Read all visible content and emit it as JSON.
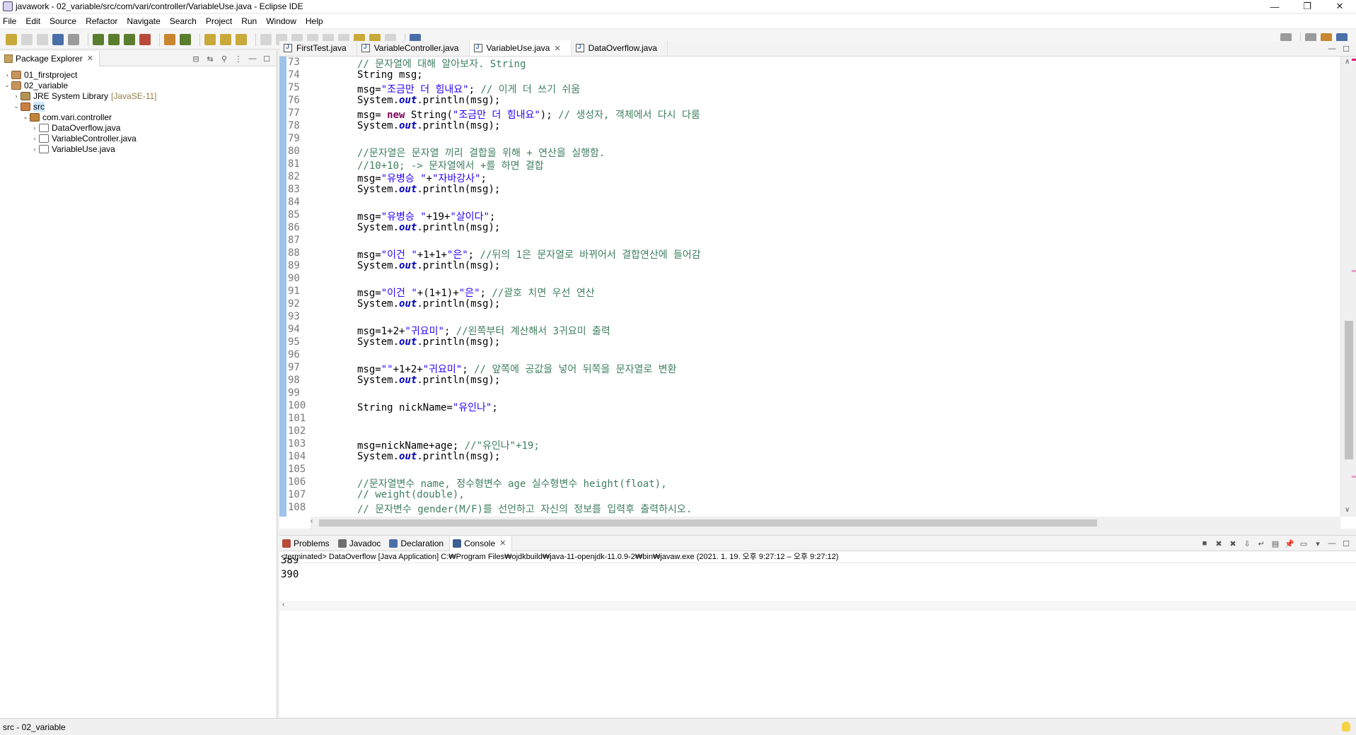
{
  "window": {
    "title": "javawork - 02_variable/src/com/vari/controller/VariableUse.java - Eclipse IDE",
    "controls": [
      "—",
      "❐",
      "✕"
    ]
  },
  "menu": [
    "File",
    "Edit",
    "Source",
    "Refactor",
    "Navigate",
    "Search",
    "Project",
    "Run",
    "Window",
    "Help"
  ],
  "explorer": {
    "tab_label": "Package Explorer",
    "close": "✕",
    "tree": [
      {
        "label": "01_firstproject",
        "icon": "project-icon",
        "depth": 0,
        "arrow": "›"
      },
      {
        "label": "02_variable",
        "icon": "project-icon",
        "depth": 0,
        "arrow": "⌄"
      },
      {
        "label": "JRE System Library",
        "suffix": "[JavaSE-11]",
        "icon": "library-icon",
        "depth": 1,
        "arrow": "›"
      },
      {
        "label": "src",
        "icon": "source-folder-icon",
        "depth": 1,
        "arrow": "⌄",
        "selected": true
      },
      {
        "label": "com.vari.controller",
        "icon": "package-icon",
        "depth": 2,
        "arrow": "⌄"
      },
      {
        "label": "DataOverflow.java",
        "icon": "java-file-icon",
        "depth": 3,
        "arrow": "›"
      },
      {
        "label": "VariableController.java",
        "icon": "java-file-icon",
        "depth": 3,
        "arrow": "›"
      },
      {
        "label": "VariableUse.java",
        "icon": "java-file-icon",
        "depth": 3,
        "arrow": "›"
      }
    ]
  },
  "editor": {
    "tabs": [
      {
        "label": "FirstTest.java",
        "active": false
      },
      {
        "label": "VariableController.java",
        "active": false
      },
      {
        "label": "VariableUse.java",
        "active": true,
        "close": "✕"
      },
      {
        "label": "DataOverflow.java",
        "active": false
      }
    ],
    "lines": [
      {
        "n": "73",
        "seg": [
          [
            "cm",
            "// 문자열에 대해 알아보자. String"
          ]
        ]
      },
      {
        "n": "74",
        "seg": [
          [
            "",
            "String msg;"
          ]
        ]
      },
      {
        "n": "75",
        "seg": [
          [
            "",
            "msg="
          ],
          [
            "st",
            "\"조금만 더 힘내요\""
          ],
          [
            "",
            "; "
          ],
          [
            "cm",
            "// 이게 더 쓰기 쉬움"
          ]
        ]
      },
      {
        "n": "76",
        "seg": [
          [
            "",
            "System."
          ],
          [
            "fld",
            "out"
          ],
          [
            "",
            ".println(msg);"
          ]
        ]
      },
      {
        "n": "77",
        "seg": [
          [
            "",
            "msg= "
          ],
          [
            "kw",
            "new"
          ],
          [
            "",
            " String("
          ],
          [
            "st",
            "\"조금만 더 힘내요\""
          ],
          [
            "",
            "); "
          ],
          [
            "cm",
            "// 생성자, 객체에서 다시 다룸"
          ]
        ]
      },
      {
        "n": "78",
        "seg": [
          [
            "",
            "System."
          ],
          [
            "fld",
            "out"
          ],
          [
            "",
            ".println(msg);"
          ]
        ]
      },
      {
        "n": "79",
        "seg": []
      },
      {
        "n": "80",
        "seg": [
          [
            "cm",
            "//문자열은 문자열 끼리 결합을 위해 + 연산을 실행함."
          ]
        ]
      },
      {
        "n": "81",
        "seg": [
          [
            "cm",
            "//10+10; -> 문자열에서 +를 하면 결합"
          ]
        ]
      },
      {
        "n": "82",
        "seg": [
          [
            "",
            "msg="
          ],
          [
            "st",
            "\"유병승 \""
          ],
          [
            "",
            "+"
          ],
          [
            "st",
            "\"자바강사\""
          ],
          [
            "",
            ";"
          ]
        ]
      },
      {
        "n": "83",
        "seg": [
          [
            "",
            "System."
          ],
          [
            "fld",
            "out"
          ],
          [
            "",
            ".println(msg);"
          ]
        ]
      },
      {
        "n": "84",
        "seg": []
      },
      {
        "n": "85",
        "seg": [
          [
            "",
            "msg="
          ],
          [
            "st",
            "\"유병승 \""
          ],
          [
            "",
            "+19+"
          ],
          [
            "st",
            "\"살이다\""
          ],
          [
            "",
            ";"
          ]
        ]
      },
      {
        "n": "86",
        "seg": [
          [
            "",
            "System."
          ],
          [
            "fld",
            "out"
          ],
          [
            "",
            ".println(msg);"
          ]
        ]
      },
      {
        "n": "87",
        "seg": []
      },
      {
        "n": "88",
        "seg": [
          [
            "",
            "msg="
          ],
          [
            "st",
            "\"이건 \""
          ],
          [
            "",
            "+1+1+"
          ],
          [
            "st",
            "\"은\""
          ],
          [
            "",
            "; "
          ],
          [
            "cm",
            "//뒤의 1은 문자열로 바뀌어서 결합연산에 들어감"
          ]
        ]
      },
      {
        "n": "89",
        "seg": [
          [
            "",
            "System."
          ],
          [
            "fld",
            "out"
          ],
          [
            "",
            ".println(msg);"
          ]
        ]
      },
      {
        "n": "90",
        "seg": []
      },
      {
        "n": "91",
        "seg": [
          [
            "",
            "msg="
          ],
          [
            "st",
            "\"이건 \""
          ],
          [
            "",
            "+(1+1)+"
          ],
          [
            "st",
            "\"은\""
          ],
          [
            "",
            "; "
          ],
          [
            "cm",
            "//괄호 치면 우선 연산"
          ]
        ]
      },
      {
        "n": "92",
        "seg": [
          [
            "",
            "System."
          ],
          [
            "fld",
            "out"
          ],
          [
            "",
            ".println(msg);"
          ]
        ]
      },
      {
        "n": "93",
        "seg": []
      },
      {
        "n": "94",
        "seg": [
          [
            "",
            "msg=1+2+"
          ],
          [
            "st",
            "\"귀요미\""
          ],
          [
            "",
            "; "
          ],
          [
            "cm",
            "//왼쪽부터 계산해서 3귀요미 출력"
          ]
        ]
      },
      {
        "n": "95",
        "seg": [
          [
            "",
            "System."
          ],
          [
            "fld",
            "out"
          ],
          [
            "",
            ".println(msg);"
          ]
        ]
      },
      {
        "n": "96",
        "seg": []
      },
      {
        "n": "97",
        "seg": [
          [
            "",
            "msg="
          ],
          [
            "st",
            "\"\""
          ],
          [
            "",
            "+1+2+"
          ],
          [
            "st",
            "\"귀요미\""
          ],
          [
            "",
            "; "
          ],
          [
            "cm",
            "// 앞쪽에 공값을 넣어 뒤쪽을 문자열로 변환"
          ]
        ]
      },
      {
        "n": "98",
        "seg": [
          [
            "",
            "System."
          ],
          [
            "fld",
            "out"
          ],
          [
            "",
            ".println(msg);"
          ]
        ]
      },
      {
        "n": "99",
        "seg": []
      },
      {
        "n": "100",
        "seg": [
          [
            "",
            "String nickName="
          ],
          [
            "st",
            "\"유인나\""
          ],
          [
            "",
            ";"
          ]
        ]
      },
      {
        "n": "101",
        "seg": []
      },
      {
        "n": "102",
        "seg": []
      },
      {
        "n": "103",
        "seg": [
          [
            "",
            "msg=nickName+age; "
          ],
          [
            "cm",
            "//\"유인나\"+19;"
          ]
        ]
      },
      {
        "n": "104",
        "seg": [
          [
            "",
            "System."
          ],
          [
            "fld",
            "out"
          ],
          [
            "",
            ".println(msg);"
          ]
        ]
      },
      {
        "n": "105",
        "seg": []
      },
      {
        "n": "106",
        "seg": [
          [
            "cm",
            "//문자열변수 name, 정수형변수 age 실수형변수 height(float),"
          ]
        ]
      },
      {
        "n": "107",
        "seg": [
          [
            "cm",
            "// weight(double),"
          ]
        ]
      },
      {
        "n": "108",
        "seg": [
          [
            "cm",
            "// 문자변수 gender(M/F)를 선언하고 자신의 정보를 입력후 출력하시오."
          ]
        ]
      }
    ]
  },
  "console_panel": {
    "tabs": [
      {
        "label": "Problems",
        "icon": "problems-icon"
      },
      {
        "label": "Javadoc",
        "icon": "javadoc-icon"
      },
      {
        "label": "Declaration",
        "icon": "declaration-icon"
      },
      {
        "label": "Console",
        "icon": "console-icon",
        "active": true,
        "close": "✕"
      }
    ],
    "status": "<terminated> DataOverflow [Java Application] C:₩Program Files₩ojdkbuild₩java-11-openjdk-11.0.9-2₩bin₩javaw.exe  (2021. 1. 19. 오후 9:27:12 – 오후 9:27:12)",
    "prev_output": "389",
    "output": "390"
  },
  "statusbar": {
    "text": "src - 02_variable"
  },
  "colors": {
    "comment": "#3f7f5f",
    "string": "#2a00ff",
    "keyword": "#7f0055",
    "field": "#0000c0",
    "ruler": "#9ec3eb"
  }
}
